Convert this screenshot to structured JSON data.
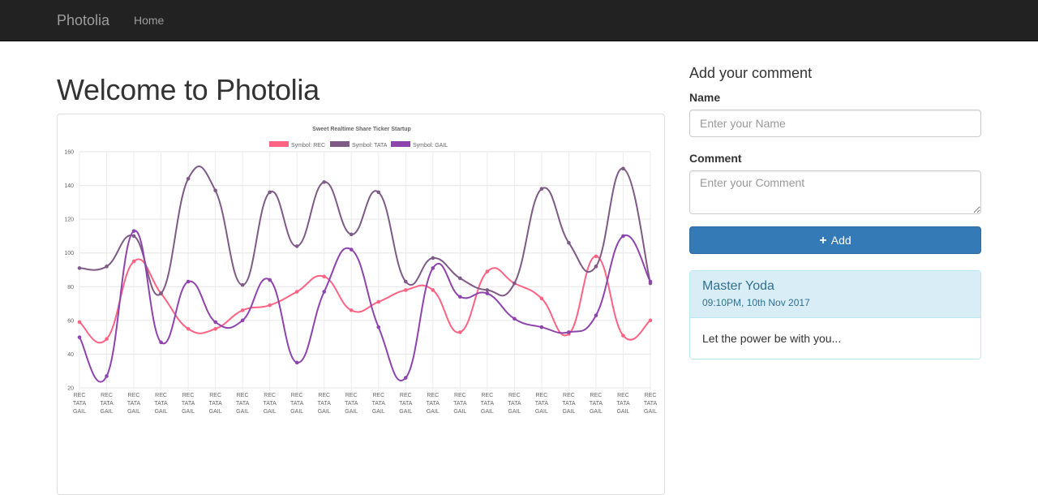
{
  "navbar": {
    "brand": "Photolia",
    "home": "Home"
  },
  "page_title": "Welcome to Photolia",
  "comment_form": {
    "heading": "Add your comment",
    "name_label": "Name",
    "name_placeholder": "Enter your Name",
    "comment_label": "Comment",
    "comment_placeholder": "Enter your Comment",
    "add_icon": "plus-icon",
    "add_label": "Add"
  },
  "comments": [
    {
      "author": "Master Yoda",
      "time": "09:10PM, 10th Nov 2017",
      "text": "Let the power be with you..."
    }
  ],
  "colors": {
    "rec": "#ff6384",
    "tata": "#7e5a86",
    "gail": "#8e44ad",
    "primary": "#337ab7"
  },
  "chart_data": {
    "type": "line",
    "title": "Sweet Realtime Share Ticker Startup",
    "legend_position": "top",
    "grid": true,
    "xlabel": "",
    "ylabel": "",
    "ylim": [
      20,
      160
    ],
    "yticks": [
      20,
      40,
      60,
      80,
      100,
      120,
      140,
      160
    ],
    "x_tick_label": [
      "REC",
      "TATA",
      "GAIL"
    ],
    "point_count": 22,
    "series": [
      {
        "name": "Symbol: REC",
        "color": "#ff6384",
        "values": [
          59,
          49,
          95,
          76,
          55,
          55,
          66,
          69,
          77,
          86,
          66,
          71,
          78,
          78,
          53,
          89,
          82,
          73,
          52,
          98,
          51,
          60
        ]
      },
      {
        "name": "Symbol: TATA",
        "color": "#7e5a86",
        "values": [
          91,
          92,
          110,
          76,
          144,
          137,
          81,
          136,
          104,
          142,
          111,
          136,
          83,
          97,
          85,
          78,
          82,
          138,
          106,
          92,
          150,
          82
        ]
      },
      {
        "name": "Symbol: GAIL",
        "color": "#8e44ad",
        "values": [
          50,
          27,
          113,
          47,
          83,
          59,
          60,
          84,
          35,
          77,
          102,
          56,
          26,
          91,
          74,
          76,
          61,
          56,
          53,
          63,
          110,
          83
        ]
      }
    ]
  }
}
